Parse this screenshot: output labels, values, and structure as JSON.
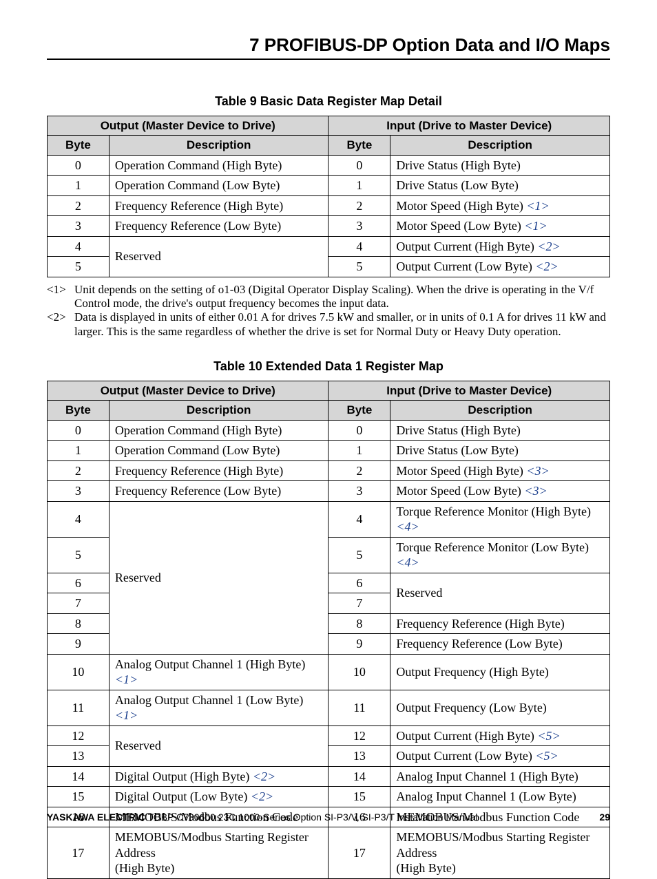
{
  "header": "7  PROFIBUS-DP Option Data and I/O Maps",
  "table9": {
    "title": "Table 9  Basic Data Register Map Detail",
    "outHead": "Output (Master Device to Drive)",
    "inHead": "Input (Drive to Master Device)",
    "byteHead": "Byte",
    "descHead": "Description",
    "rows": [
      {
        "ob": "0",
        "od": "Operation Command (High Byte)",
        "ib": "0",
        "id": "Drive Status (High Byte)"
      },
      {
        "ob": "1",
        "od": "Operation Command (Low Byte)",
        "ib": "1",
        "id": "Drive Status (Low Byte)"
      },
      {
        "ob": "2",
        "od": "Frequency Reference (High Byte)",
        "ib": "2",
        "id": "Motor Speed (High Byte)",
        "iref": "<1>"
      },
      {
        "ob": "3",
        "od": "Frequency Reference (Low Byte)",
        "ib": "3",
        "id": "Motor Speed (Low Byte)",
        "iref": "<1>"
      },
      {
        "ob": "4",
        "od": "Reserved",
        "odspan": 2,
        "ib": "4",
        "id": "Output Current (High Byte)",
        "iref": "<2>"
      },
      {
        "ob": "5",
        "ib": "5",
        "id": "Output Current (Low Byte)",
        "iref": "<2>"
      }
    ]
  },
  "notes9": [
    {
      "tag": "<1>",
      "txt": "Unit depends on the setting of o1-03 (Digital Operator Display Scaling). When the drive is operating in the V/f Control mode, the drive's output frequency becomes the input data."
    },
    {
      "tag": "<2>",
      "txt": "Data is displayed in units of either 0.01 A for drives 7.5 kW and smaller, or in units of 0.1 A for drives 11 kW and larger. This is the same regardless of whether the drive is set for Normal Duty or Heavy Duty operation."
    }
  ],
  "table10": {
    "title": "Table 10  Extended Data 1 Register Map",
    "outHead": "Output (Master Device to Drive)",
    "inHead": "Input (Drive to Master Device)",
    "byteHead": "Byte",
    "descHead": "Description",
    "rows": [
      {
        "ob": "0",
        "od": "Operation Command (High Byte)",
        "ib": "0",
        "id": "Drive Status (High Byte)"
      },
      {
        "ob": "1",
        "od": "Operation Command (Low Byte)",
        "ib": "1",
        "id": "Drive Status (Low Byte)"
      },
      {
        "ob": "2",
        "od": "Frequency Reference (High Byte)",
        "ib": "2",
        "id": "Motor Speed (High Byte)",
        "iref": "<3>"
      },
      {
        "ob": "3",
        "od": "Frequency Reference (Low Byte)",
        "ib": "3",
        "id": "Motor Speed (Low Byte)",
        "iref": "<3>"
      },
      {
        "ob": "4",
        "od": "Reserved",
        "odspan": 6,
        "ib": "4",
        "id": "Torque Reference Monitor (High Byte)",
        "iref": "<4>"
      },
      {
        "ob": "5",
        "ib": "5",
        "id": "Torque Reference Monitor (Low Byte)",
        "iref": "<4>"
      },
      {
        "ob": "6",
        "ib": "6",
        "id": "Reserved",
        "idspan": 2
      },
      {
        "ob": "7",
        "ib": "7"
      },
      {
        "ob": "8",
        "ib": "8",
        "id": "Frequency Reference (High Byte)"
      },
      {
        "ob": "9",
        "ib": "9",
        "id": "Frequency Reference (Low Byte)"
      },
      {
        "ob": "10",
        "od": "Analog Output Channel 1 (High Byte)",
        "oref": "<1>",
        "ib": "10",
        "id": "Output Frequency (High Byte)"
      },
      {
        "ob": "11",
        "od": "Analog Output Channel 1 (Low Byte)",
        "oref": "<1>",
        "ib": "11",
        "id": "Output Frequency (Low Byte)"
      },
      {
        "ob": "12",
        "od": "Reserved",
        "odspan": 2,
        "ib": "12",
        "id": "Output Current (High Byte)",
        "iref": "<5>"
      },
      {
        "ob": "13",
        "ib": "13",
        "id": "Output Current (Low Byte)",
        "iref": "<5>"
      },
      {
        "ob": "14",
        "od": "Digital Output (High Byte)",
        "oref": "<2>",
        "ib": "14",
        "id": "Analog Input Channel 1 (High Byte)"
      },
      {
        "ob": "15",
        "od": "Digital Output (Low Byte)",
        "oref": "<2>",
        "ib": "15",
        "id": "Analog Input Channel 1 (Low Byte)"
      },
      {
        "ob": "16",
        "od": "MEMOBUS/Modbus Function Code",
        "ib": "16",
        "id": "MEMOBUS/Modbus Function Code"
      },
      {
        "ob": "17",
        "od": "MEMOBUS/Modbus Starting Register Address\n(High Byte)",
        "ib": "17",
        "id": "MEMOBUS/Modbus Starting Register Address\n(High Byte)"
      }
    ]
  },
  "footer": {
    "brand": "YASKAWA ELECTRIC",
    "doc": " TOBP C730600 23C 1000-Series Option SI-P3/V, SI-P3/T Installation Manual",
    "page": "29"
  }
}
